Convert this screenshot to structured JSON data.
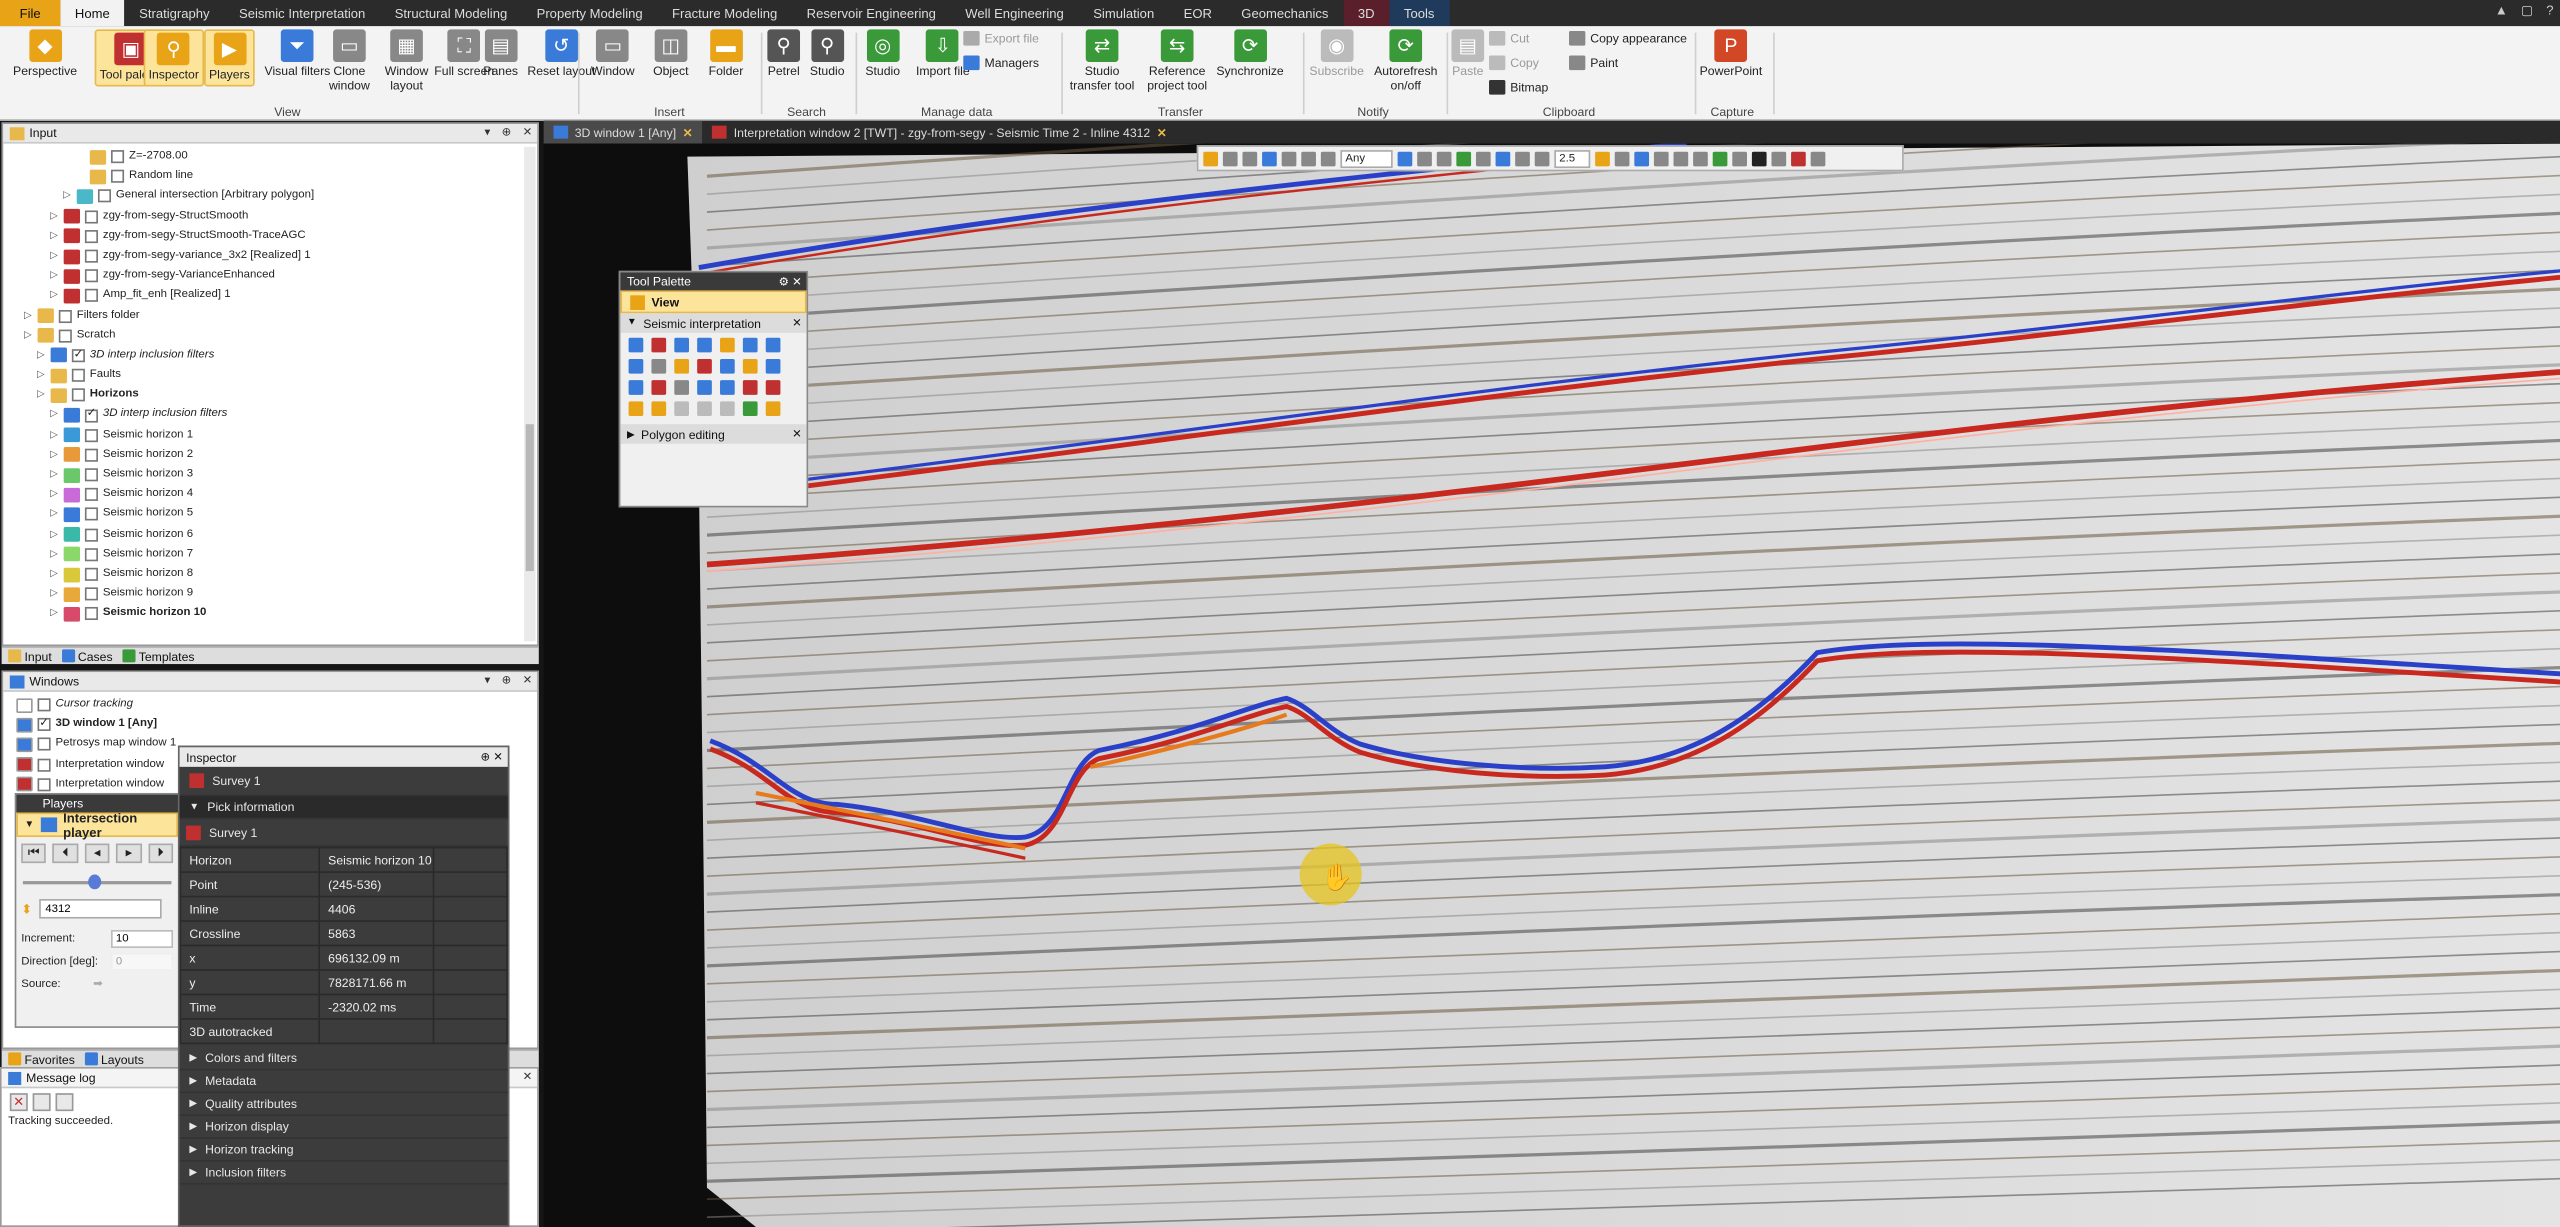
{
  "menu": {
    "tabs": [
      "File",
      "Home",
      "Stratigraphy",
      "Seismic Interpretation",
      "Structural Modeling",
      "Property Modeling",
      "Fracture Modeling",
      "Reservoir Engineering",
      "Well Engineering",
      "Simulation",
      "EOR",
      "Geomechanics",
      "3D",
      "Tools"
    ],
    "active_tab": "Home"
  },
  "ribbon": {
    "view_buttons": [
      "Perspective",
      "Tool palette",
      "Inspector",
      "Players",
      "Visual filters",
      "Clone window",
      "Window layout",
      "Full screen",
      "Panes",
      "Reset layout"
    ],
    "view_group": "View",
    "insert_buttons": [
      "Window",
      "Object",
      "Folder"
    ],
    "insert_group": "Insert",
    "search_buttons": [
      "Petrel",
      "Studio"
    ],
    "search_group": "Search",
    "manage_buttons": [
      "Studio",
      "Import file"
    ],
    "manage_small": [
      "Export file",
      "Managers"
    ],
    "manage_group": "Manage data",
    "transfer_buttons": [
      "Studio transfer tool",
      "Reference project tool",
      "Synchronize"
    ],
    "transfer_group": "Transfer",
    "notify_buttons": [
      "Subscribe",
      "Autorefresh on/off"
    ],
    "notify_group": "Notify",
    "clipboard_buttons": [
      "Paste"
    ],
    "clipboard_small": [
      "Cut",
      "Copy",
      "Bitmap",
      "Copy appearance",
      "Paint"
    ],
    "clipboard_group": "Clipboard",
    "capture_buttons": [
      "PowerPoint"
    ],
    "capture_group": "Capture"
  },
  "input_panel": {
    "title": "Input",
    "rows": [
      {
        "label": "Z=-2708.00",
        "indent": 5,
        "icon": "#e8b84a",
        "check": false,
        "style": ""
      },
      {
        "label": "Random line",
        "indent": 5,
        "icon": "#e8b84a",
        "check": false,
        "style": ""
      },
      {
        "label": "General intersection [Arbitrary polygon]",
        "indent": 4,
        "icon": "#4ab8c8",
        "check": false,
        "style": ""
      },
      {
        "label": "zgy-from-segy-StructSmooth",
        "indent": 3,
        "icon": "#c03030",
        "check": false,
        "style": ""
      },
      {
        "label": "zgy-from-segy-StructSmooth-TraceAGC",
        "indent": 3,
        "icon": "#c03030",
        "check": false,
        "style": ""
      },
      {
        "label": "zgy-from-segy-variance_3x2 [Realized] 1",
        "indent": 3,
        "icon": "#c03030",
        "check": false,
        "style": ""
      },
      {
        "label": "zgy-from-segy-VarianceEnhanced",
        "indent": 3,
        "icon": "#c03030",
        "check": false,
        "style": ""
      },
      {
        "label": "Amp_fit_enh [Realized] 1",
        "indent": 3,
        "icon": "#c03030",
        "check": false,
        "style": ""
      },
      {
        "label": "Filters folder",
        "indent": 1,
        "icon": "#e8b84a",
        "check": false,
        "style": ""
      },
      {
        "label": "Scratch",
        "indent": 1,
        "icon": "#e8b84a",
        "check": false,
        "style": ""
      },
      {
        "label": "3D interp inclusion filters",
        "indent": 2,
        "icon": "#3a7ad8",
        "check": true,
        "style": "it"
      },
      {
        "label": "Faults",
        "indent": 2,
        "icon": "#e8b84a",
        "check": false,
        "style": ""
      },
      {
        "label": "Horizons",
        "indent": 2,
        "icon": "#e8b84a",
        "check": false,
        "style": "bold"
      },
      {
        "label": "3D interp inclusion filters",
        "indent": 3,
        "icon": "#3a7ad8",
        "check": true,
        "style": "it"
      },
      {
        "label": "Seismic horizon 1",
        "indent": 3,
        "icon": "#3a9ad8",
        "check": false,
        "style": ""
      },
      {
        "label": "Seismic horizon 2",
        "indent": 3,
        "icon": "#e89a3a",
        "check": false,
        "style": ""
      },
      {
        "label": "Seismic horizon 3",
        "indent": 3,
        "icon": "#6ac86a",
        "check": false,
        "style": ""
      },
      {
        "label": "Seismic horizon 4",
        "indent": 3,
        "icon": "#c86ad8",
        "check": false,
        "style": ""
      },
      {
        "label": "Seismic horizon 5",
        "indent": 3,
        "icon": "#3a7ad8",
        "check": false,
        "style": ""
      },
      {
        "label": "Seismic horizon 6",
        "indent": 3,
        "icon": "#3ab8a8",
        "check": false,
        "style": ""
      },
      {
        "label": "Seismic horizon 7",
        "indent": 3,
        "icon": "#8ad86a",
        "check": false,
        "style": ""
      },
      {
        "label": "Seismic horizon 8",
        "indent": 3,
        "icon": "#d8c83a",
        "check": false,
        "style": ""
      },
      {
        "label": "Seismic horizon 9",
        "indent": 3,
        "icon": "#e8a83a",
        "check": false,
        "style": ""
      },
      {
        "label": "Seismic horizon 10",
        "indent": 3,
        "icon": "#d84a6a",
        "check": false,
        "style": "bold"
      }
    ],
    "tabs": [
      "Input",
      "Cases",
      "Templates"
    ]
  },
  "windows_panel": {
    "title": "Windows",
    "rows": [
      {
        "label": "Cursor tracking",
        "style": "it"
      },
      {
        "label": "3D window 1 [Any]",
        "style": "bold"
      },
      {
        "label": "Petrosys map window 1",
        "style": ""
      },
      {
        "label": "Interpretation window",
        "style": ""
      },
      {
        "label": "Interpretation window",
        "style": ""
      }
    ]
  },
  "players": {
    "title": "Players",
    "header": "Intersection player",
    "value": "4312",
    "increment_label": "Increment:",
    "increment": "10",
    "direction_label": "Direction [deg]:",
    "direction": "0",
    "source_label": "Source:"
  },
  "bottom_tabs": [
    "Favorites",
    "Layouts"
  ],
  "message_log": {
    "title": "Message log",
    "text": "Tracking succeeded."
  },
  "inspector": {
    "title": "Inspector",
    "survey": "Survey 1",
    "section_pick": "Pick information",
    "sub_survey": "Survey 1",
    "rows": [
      {
        "k": "Horizon",
        "v": "Seismic horizon 10"
      },
      {
        "k": "Point",
        "v": "(245-536)"
      },
      {
        "k": "Inline",
        "v": "4406"
      },
      {
        "k": "Crossline",
        "v": "5863"
      },
      {
        "k": "x",
        "v": "696132.09 m"
      },
      {
        "k": "y",
        "v": "7828171.66 m"
      },
      {
        "k": "Time",
        "v": "-2320.02 ms"
      },
      {
        "k": "3D autotracked",
        "v": ""
      }
    ],
    "sections": [
      "Colors and filters",
      "Metadata",
      "Quality attributes",
      "Horizon display",
      "Horizon tracking",
      "Inclusion filters"
    ]
  },
  "view_tabs": [
    {
      "label": "3D window 1 [Any]",
      "active": true
    },
    {
      "label": "Interpretation window 2 [TWT] - zgy-from-segy - Seismic Time 2 - Inline 4312",
      "active": false
    }
  ],
  "float_toolbar": {
    "domain": "Any",
    "zoom": "2.5"
  },
  "tool_palette": {
    "title": "Tool Palette",
    "view": "View",
    "section1": "Seismic interpretation",
    "section2": "Polygon editing"
  },
  "colors": {
    "accent": "#e8a317",
    "highlight": "#fde49b",
    "horizon_red": "#c8281e",
    "horizon_blue": "#2a40c8",
    "horizon_orange": "#e87a1e"
  }
}
